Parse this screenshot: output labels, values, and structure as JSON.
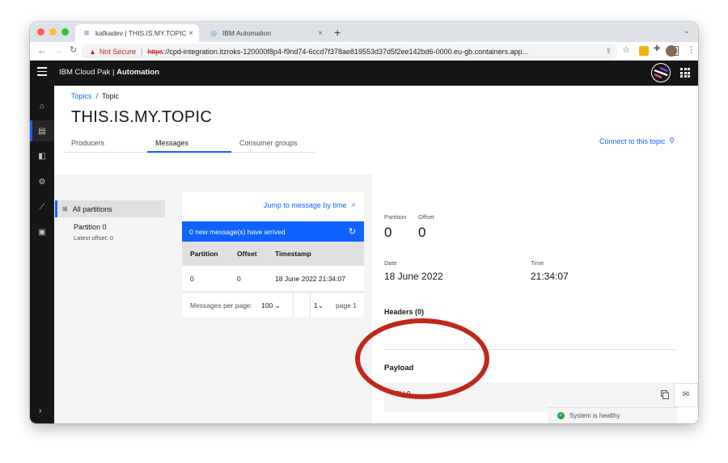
{
  "browser": {
    "tabs": [
      {
        "label": "kafkadev | THIS.IS.MY.TOPIC |",
        "close": "×"
      },
      {
        "label": "IBM Automation",
        "close": "×"
      }
    ],
    "new_tab": "+",
    "tab_menu": "⌄",
    "security_label": "Not Secure",
    "url_scheme": "https",
    "url_rest": "://cpd-integration.itzroks-120000f8p4-f9nd74-6ccd7f378ae819553d37d5f2ee142bd6-0000.eu-gb.containers.app..."
  },
  "app": {
    "brand_prefix": "IBM Cloud Pak",
    "brand_sep": " | ",
    "brand_name": "Automation"
  },
  "breadcrumb": {
    "link": "Topics",
    "sep": "/",
    "current": "Topic"
  },
  "page_title": "THIS.IS.MY.TOPIC",
  "tabs": [
    "Producers",
    "Messages",
    "Consumer groups"
  ],
  "connect_label": "Connect to this topic",
  "partitions": {
    "all_label": "All partitions",
    "items": [
      {
        "name": "Partition 0",
        "latest": "Latest offset: 0"
      }
    ]
  },
  "messages": {
    "jump_label": "Jump to message by time",
    "banner": "0 new message(s) have arrived",
    "headers": [
      "Partition",
      "Offset",
      "Timestamp"
    ],
    "rows": [
      {
        "partition": "0",
        "offset": "0",
        "timestamp": "18 June 2022 21:34:07"
      }
    ],
    "per_page_label": "Messages per page:",
    "per_page_value": "100",
    "page_select": "1",
    "page_label": "page 1"
  },
  "details": {
    "partition_label": "Partition",
    "partition_value": "0",
    "offset_label": "Offset",
    "offset_value": "0",
    "date_label": "Date",
    "date_value": "18 June 2022",
    "time_label": "Time",
    "time_value": "21:34:07",
    "headers_title": "Headers (0)",
    "payload_title": "Payload",
    "payload_value": "HELLO"
  },
  "status": {
    "health": "System is healthy"
  },
  "colors": {
    "accent": "#0f62fe",
    "header_bg": "#161616",
    "annotation": "#c0271a",
    "healthy": "#24a148"
  }
}
